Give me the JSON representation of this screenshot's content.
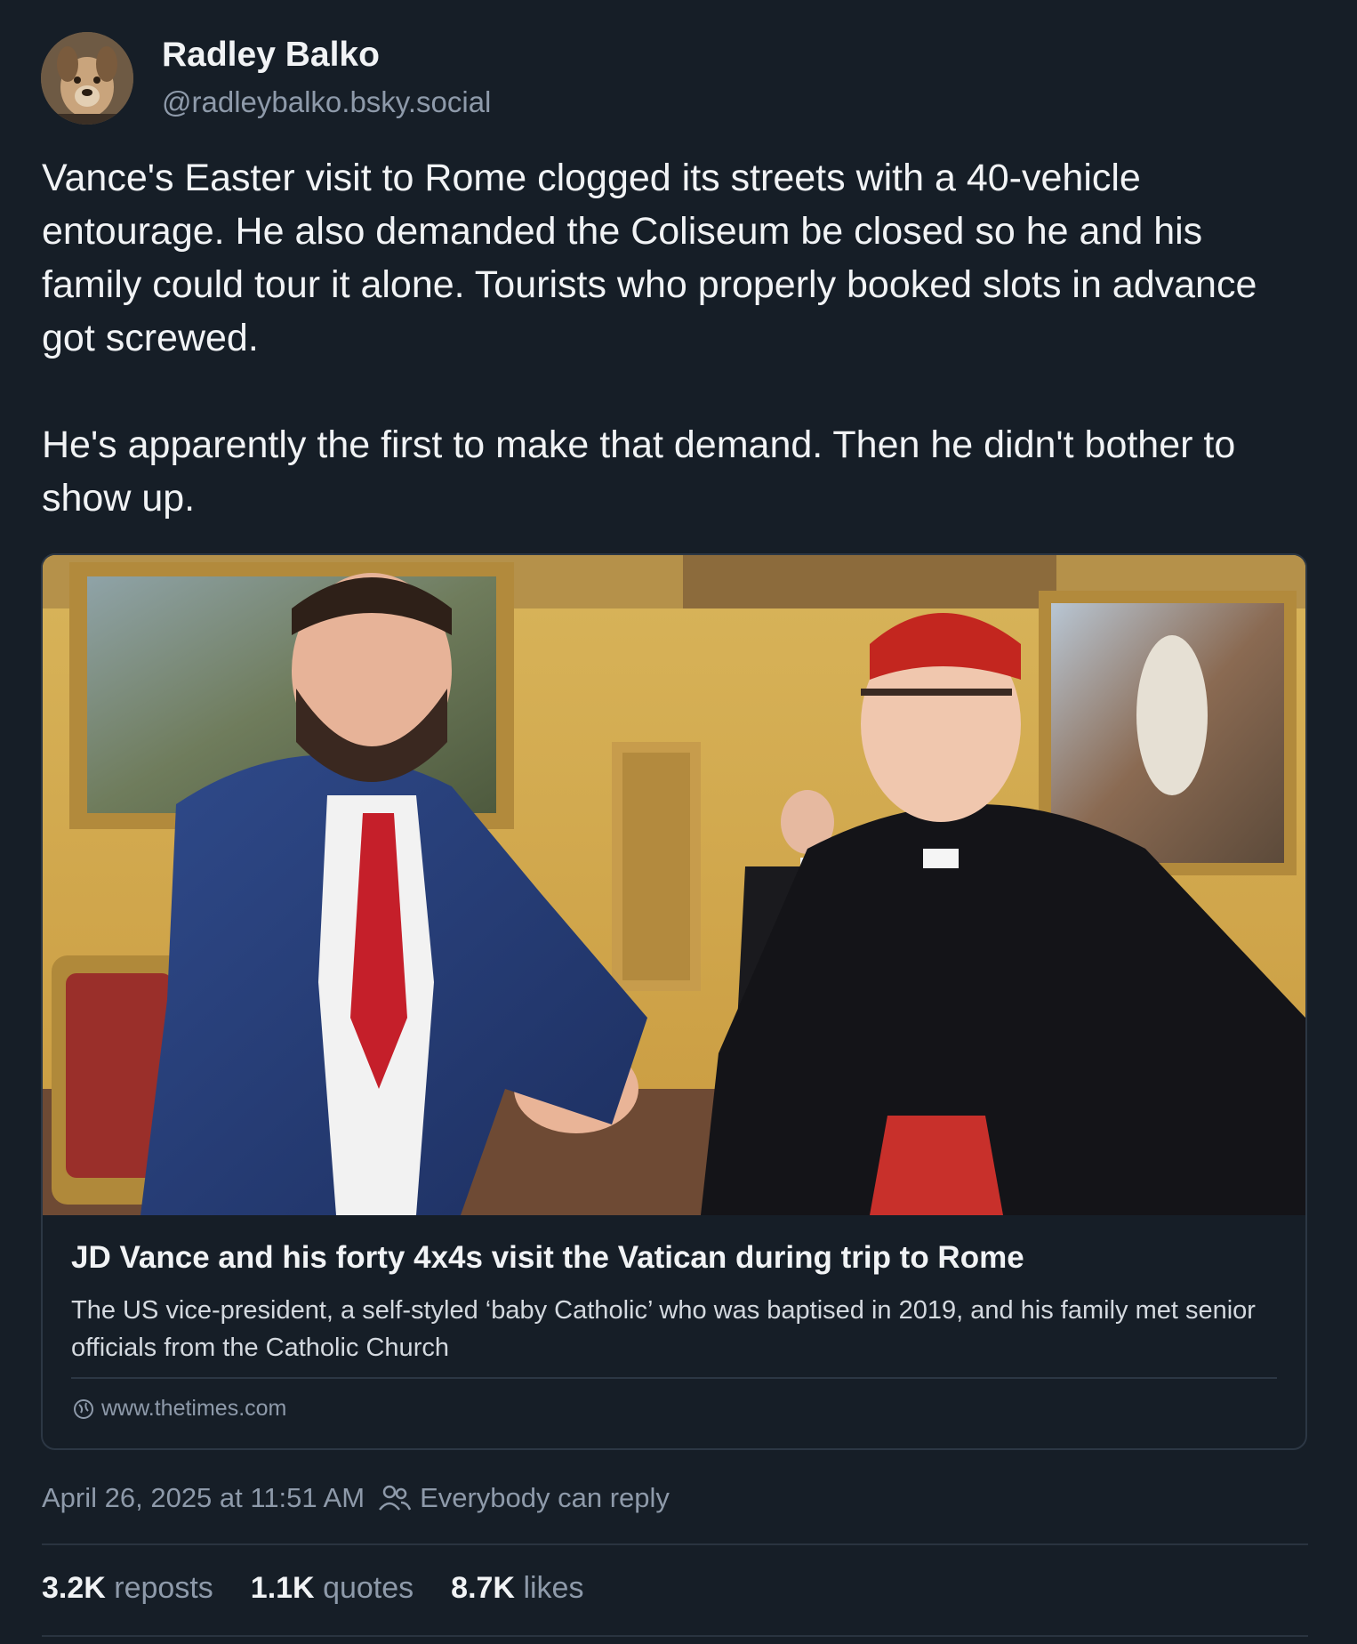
{
  "author": {
    "name": "Radley Balko",
    "handle": "@radleybalko.bsky.social",
    "avatar_icon": "dog-avatar"
  },
  "post": {
    "paragraphs": [
      "Vance's Easter visit to Rome clogged its streets with a 40-vehicle entourage. He also demanded the Coliseum be closed so he and his family could tour it alone. Tourists who properly booked slots in advance got screwed.",
      "He's apparently the first to make that demand. Then he didn't bother to show up."
    ]
  },
  "link_card": {
    "title": "JD Vance and his forty 4x4s visit the Vatican during trip to Rome",
    "description": "The US vice-president, a self-styled ‘baby Catholic’ who was baptised in 2019, and his family met senior officials from the Catholic Church",
    "domain": "www.thetimes.com",
    "domain_icon": "globe-icon"
  },
  "meta": {
    "timestamp": "April 26, 2025 at 11:51 AM",
    "reply_setting": "Everybody can reply",
    "reply_icon": "people-icon"
  },
  "stats": {
    "reposts_count": "3.2K",
    "reposts_label": "reposts",
    "quotes_count": "1.1K",
    "quotes_label": "quotes",
    "likes_count": "8.7K",
    "likes_label": "likes"
  },
  "colors": {
    "background": "#161e27",
    "text": "#f1f3f5",
    "muted": "#8e9aaa",
    "border": "#2c3744"
  }
}
